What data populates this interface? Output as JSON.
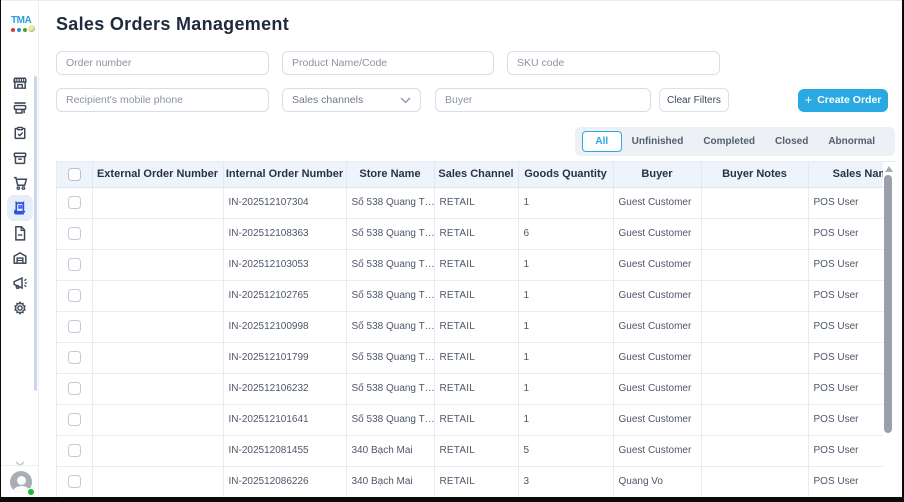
{
  "sidebar": {
    "logo_text": "TMA",
    "logo_dot_colors": [
      "#d93a2b",
      "#2b8fd8",
      "#4ea31f"
    ],
    "items": [
      {
        "icon": "storefront-icon",
        "active": false
      },
      {
        "icon": "pos-counter-icon",
        "active": false
      },
      {
        "icon": "clipboard-check-icon",
        "active": false
      },
      {
        "icon": "archive-box-icon",
        "active": false
      },
      {
        "icon": "shopping-cart-icon",
        "active": false
      },
      {
        "icon": "sales-order-receipt-icon",
        "active": true
      },
      {
        "icon": "document-icon",
        "active": false
      },
      {
        "icon": "warehouse-icon",
        "active": false
      },
      {
        "icon": "megaphone-icon",
        "active": false
      },
      {
        "icon": "settings-gear-icon",
        "active": false
      }
    ],
    "user_status": "online"
  },
  "header": {
    "title": "Sales Orders Management"
  },
  "filters": {
    "order_number_placeholder": "Order number",
    "product_placeholder": "Product Name/Code",
    "sku_placeholder": "SKU code",
    "phone_placeholder": "Recipient's mobile phone",
    "sales_channels_label": "Sales channels",
    "buyer_placeholder": "Buyer",
    "clear_button_label": "Clear Filters",
    "create_button_label": "Create Order",
    "create_button_plus": "+"
  },
  "tabs": [
    {
      "label": "All",
      "active": true
    },
    {
      "label": "Unfinished",
      "active": false
    },
    {
      "label": "Completed",
      "active": false
    },
    {
      "label": "Closed",
      "active": false
    },
    {
      "label": "Abnormal",
      "active": false
    }
  ],
  "table": {
    "columns": {
      "external": "External Order Number",
      "internal": "Internal Order Number",
      "store": "Store Name",
      "channel": "Sales Channel",
      "qty": "Goods Quantity",
      "buyer": "Buyer",
      "notes": "Buyer Notes",
      "sales": "Sales Name"
    },
    "rows": [
      {
        "external": "",
        "internal": "IN-202512107304",
        "store": "Số 538 Quang T…",
        "channel": "RETAIL",
        "qty": "1",
        "buyer": "Guest Customer",
        "notes": "",
        "sales": "POS User"
      },
      {
        "external": "",
        "internal": "IN-202512108363",
        "store": "Số 538 Quang T…",
        "channel": "RETAIL",
        "qty": "6",
        "buyer": "Guest Customer",
        "notes": "",
        "sales": "POS User"
      },
      {
        "external": "",
        "internal": "IN-202512103053",
        "store": "Số 538 Quang T…",
        "channel": "RETAIL",
        "qty": "1",
        "buyer": "Guest Customer",
        "notes": "",
        "sales": "POS User"
      },
      {
        "external": "",
        "internal": "IN-202512102765",
        "store": "Số 538 Quang T…",
        "channel": "RETAIL",
        "qty": "1",
        "buyer": "Guest Customer",
        "notes": "",
        "sales": "POS User"
      },
      {
        "external": "",
        "internal": "IN-202512100998",
        "store": "Số 538 Quang T…",
        "channel": "RETAIL",
        "qty": "1",
        "buyer": "Guest Customer",
        "notes": "",
        "sales": "POS User"
      },
      {
        "external": "",
        "internal": "IN-202512101799",
        "store": "Số 538 Quang T…",
        "channel": "RETAIL",
        "qty": "1",
        "buyer": "Guest Customer",
        "notes": "",
        "sales": "POS User"
      },
      {
        "external": "",
        "internal": "IN-202512106232",
        "store": "Số 538 Quang T…",
        "channel": "RETAIL",
        "qty": "1",
        "buyer": "Guest Customer",
        "notes": "",
        "sales": "POS User"
      },
      {
        "external": "",
        "internal": "IN-202512101641",
        "store": "Số 538 Quang T…",
        "channel": "RETAIL",
        "qty": "1",
        "buyer": "Guest Customer",
        "notes": "",
        "sales": "POS User"
      },
      {
        "external": "",
        "internal": "IN-202512081455",
        "store": "340 Bạch Mai",
        "channel": "RETAIL",
        "qty": "5",
        "buyer": "Guest Customer",
        "notes": "",
        "sales": "POS User"
      },
      {
        "external": "",
        "internal": "IN-202512086226",
        "store": "340 Bạch Mai",
        "channel": "RETAIL",
        "qty": "3",
        "buyer": "Quang Vo",
        "notes": "",
        "sales": "POS User"
      }
    ]
  },
  "colors": {
    "accent_blue": "#29a9e1",
    "active_nav_blue": "#2d53e0",
    "title_text": "#1f2a3c",
    "table_header_bg": "#eef4fb",
    "tabbar_bg": "#edf0f4",
    "status_green": "#10bc2b"
  }
}
